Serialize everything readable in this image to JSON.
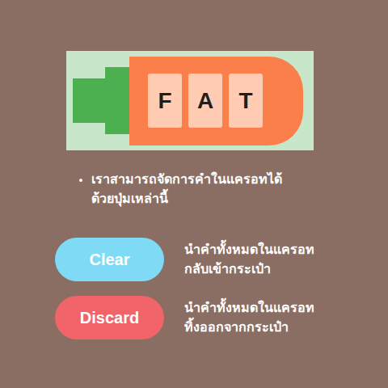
{
  "carrot": {
    "tiles": [
      "F",
      "A",
      "T"
    ]
  },
  "note": {
    "lines": [
      "เราสามารถจัดการคำในแครอทได้",
      "ด้วยปุ่มเหล่านี้"
    ]
  },
  "actions": [
    {
      "label": "Clear",
      "color": "#7fdbf5",
      "description": [
        "นำคำทั้งหมดในแครอท",
        "กลับเข้ากระเป๋า"
      ]
    },
    {
      "label": "Discard",
      "color": "#f0646a",
      "description": [
        "นำคำทั้งหมดในแครอท",
        "ทิ้งออกจากกระเป๋า"
      ]
    }
  ]
}
